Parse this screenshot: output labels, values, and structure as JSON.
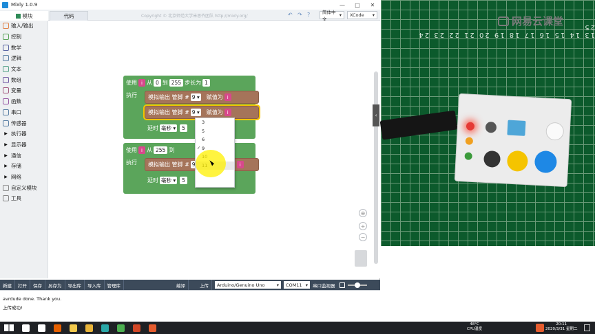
{
  "window": {
    "title": "Mixly 1.0.9",
    "controls": [
      "—",
      "□",
      "✕"
    ]
  },
  "toolbar": {
    "tab_modules": "模块",
    "tab_code": "代码",
    "copyright": "Copyright © 北京师范大学米思齐团队 http://mixly.org/",
    "language": "简体中文",
    "board_style": "XCode"
  },
  "sidebar": {
    "items": [
      {
        "label": "输入/输出",
        "icon": "io-icon",
        "color": "#e0854c"
      },
      {
        "label": "控制",
        "icon": "control-icon",
        "color": "#5ba55b"
      },
      {
        "label": "数学",
        "icon": "math-icon",
        "color": "#5b67a5"
      },
      {
        "label": "逻辑",
        "icon": "logic-icon",
        "color": "#5b80a5"
      },
      {
        "label": "文本",
        "icon": "text-icon",
        "color": "#5ba58c"
      },
      {
        "label": "数组",
        "icon": "array-icon",
        "color": "#745ba5"
      },
      {
        "label": "变量",
        "icon": "variable-icon",
        "color": "#a55b80"
      },
      {
        "label": "函数",
        "icon": "function-icon",
        "color": "#995ba5"
      },
      {
        "label": "串口",
        "icon": "serial-icon",
        "color": "#5b80a5"
      },
      {
        "label": "传感器",
        "icon": "sensor-icon",
        "color": "#5b80a5"
      }
    ],
    "groups": [
      "执行器",
      "显示器",
      "通信",
      "存储",
      "网络"
    ],
    "extras": [
      "自定义模块",
      "工具"
    ]
  },
  "blocks": {
    "loop1": {
      "use": "使用",
      "var": "i",
      "from": "从",
      "start": "0",
      "to": "到",
      "end": "255",
      "step_label": "步长为",
      "step": "1",
      "exec": "执行"
    },
    "write1": {
      "label": "模拟输出 管脚 #",
      "pin": "9 ▾",
      "assign": "赋值为",
      "var": "i"
    },
    "write2": {
      "label": "模拟输出 管脚 #",
      "pin": "9 ▾",
      "assign": "赋值为",
      "var": "i"
    },
    "delay1": {
      "label": "延时",
      "unit": "毫秒 ▾",
      "value": "5"
    },
    "loop2": {
      "use": "使用",
      "var": "i",
      "from": "从",
      "start": "255",
      "to": "到",
      "step": "-1",
      "exec": "执行"
    },
    "write3": {
      "label": "模拟输出 管脚 #",
      "pin": "9 ▾",
      "var": "i"
    },
    "delay2": {
      "label": "延时",
      "unit": "毫秒 ▾",
      "value": "5"
    }
  },
  "dropdown": {
    "options": [
      "3",
      "5",
      "6",
      "9",
      "10",
      "11"
    ],
    "selected": "9",
    "hovered": "11"
  },
  "bottombar": {
    "buttons": [
      "新建",
      "打开",
      "保存",
      "另存为",
      "导出库",
      "导入库",
      "管理库"
    ],
    "compile": "编译",
    "upload": "上传",
    "board": "Arduino/Genuino Uno",
    "port": "COM11",
    "serial_monitor": "串口监视器"
  },
  "console": {
    "line1": "avrdude done.  Thank you.",
    "line2": "上传成功!"
  },
  "camera": {
    "watermark": "网易云课堂",
    "ruler": "13 14 15 16 17 18 19 20 21 22 23 24 25"
  },
  "taskbar": {
    "temp": "48°C",
    "cpu_label": "CPU温度",
    "time": "20:11",
    "date": "2020/3/31 星期二",
    "apps": [
      {
        "name": "search-icon",
        "color": "#ffffff"
      },
      {
        "name": "task-view-icon",
        "color": "#ffffff"
      },
      {
        "name": "firefox-icon",
        "color": "#e66000"
      },
      {
        "name": "explorer-icon",
        "color": "#f2c94c"
      },
      {
        "name": "files-icon",
        "color": "#e8b339"
      },
      {
        "name": "mixly-icon",
        "color": "#2aa8a8"
      },
      {
        "name": "camtasia-icon",
        "color": "#4caf50"
      },
      {
        "name": "ppt-icon",
        "color": "#d24726"
      },
      {
        "name": "record-icon",
        "color": "#e65c2e"
      }
    ]
  }
}
